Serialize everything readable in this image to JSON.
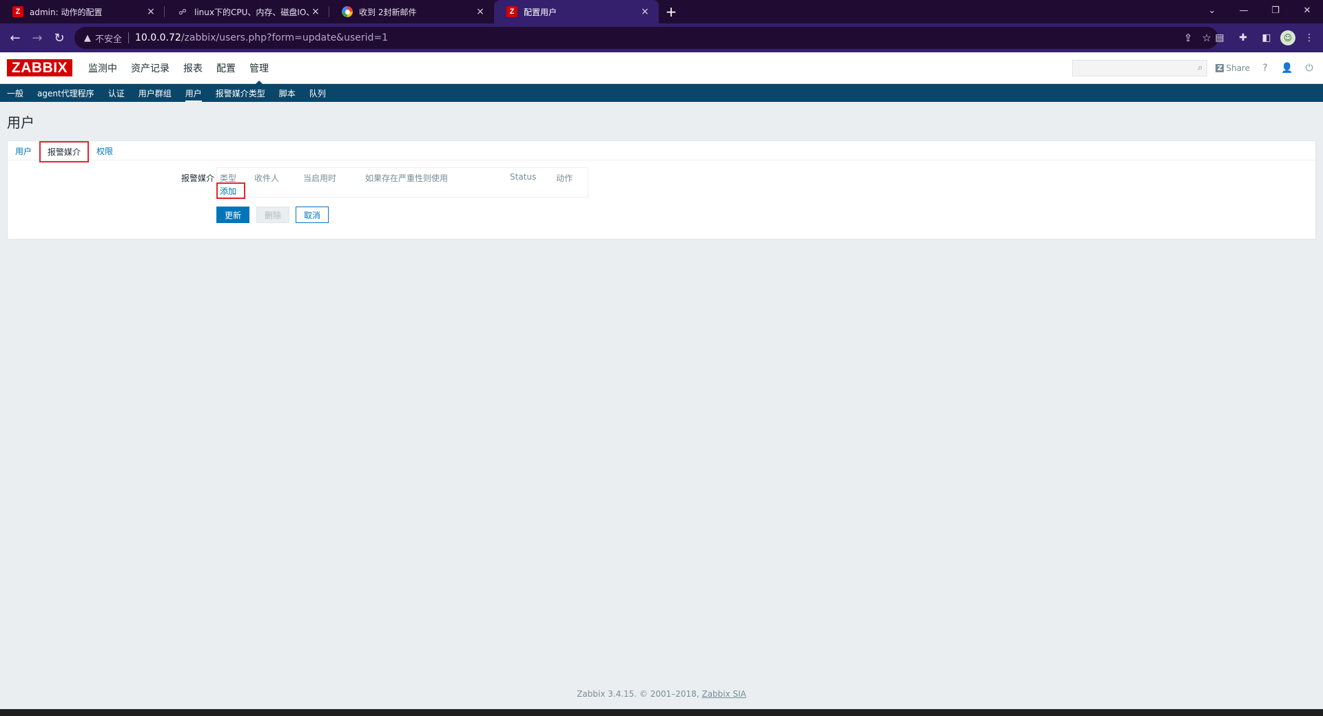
{
  "browser": {
    "tabs": [
      {
        "title": "admin: 动作的配置",
        "icon": "zabbix-icon",
        "close": "×"
      },
      {
        "title": "linux下的CPU、内存、磁盘IO、",
        "icon": "github-icon",
        "close": "×"
      },
      {
        "title": "收到 2封新邮件",
        "icon": "mail-icon",
        "close": "×"
      },
      {
        "title": "配置用户",
        "icon": "zabbix-icon",
        "close": "×"
      }
    ],
    "new_tab": "+",
    "address": {
      "insecure_label": "不安全",
      "host": "10.0.0.72",
      "path": "/zabbix/users.php?form=update&userid=1"
    }
  },
  "zabbix": {
    "logo": "ZABBIX",
    "main_menu": [
      "监测中",
      "资产记录",
      "报表",
      "配置",
      "管理"
    ],
    "main_menu_selected": "管理",
    "share_label": "Share",
    "help_label": "?",
    "sub_menu": [
      "一般",
      "agent代理程序",
      "认证",
      "用户群组",
      "用户",
      "报警媒介类型",
      "脚本",
      "队列"
    ],
    "sub_menu_selected": "用户",
    "page_title": "用户",
    "form_tabs": [
      "用户",
      "报警媒介",
      "权限"
    ],
    "form_tab_active": "报警媒介",
    "media": {
      "label": "报警媒介",
      "columns": [
        "类型",
        "收件人",
        "当启用时",
        "如果存在严重性则使用",
        "Status",
        "动作"
      ],
      "add_link": "添加"
    },
    "buttons": {
      "update": "更新",
      "delete": "删除",
      "cancel": "取消"
    },
    "footer": {
      "text": "Zabbix 3.4.15. © 2001–2018, ",
      "link": "Zabbix SIA"
    }
  },
  "colors": {
    "brand_red": "#d40000",
    "nav_blue": "#0a466a",
    "link_blue": "#0275b8",
    "highlight_red": "#e0262c",
    "browser_purple": "#35206d"
  }
}
